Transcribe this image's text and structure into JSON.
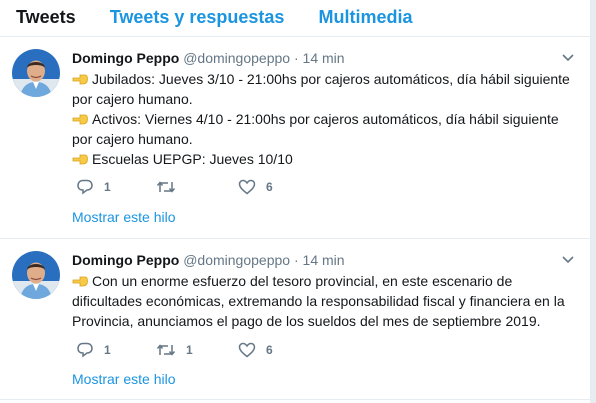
{
  "tabs": {
    "tweets": "Tweets",
    "replies": "Tweets y respuestas",
    "media": "Multimedia"
  },
  "tweets": [
    {
      "name": "Domingo Peppo",
      "handle": "@domingopeppo",
      "separator": "·",
      "time": "14 min",
      "lines": [
        "Jubilados: Jueves 3/10 - 21:00hs por cajeros automáticos, día hábil siguiente",
        "por cajero humano.",
        "Activos: Viernes 4/10 - 21:00hs por cajeros automáticos, día hábil siguiente",
        "por cajero humano.",
        "Escuelas UEPGP: Jueves 10/10"
      ],
      "replies": "1",
      "retweets": "",
      "likes": "6",
      "show_thread": "Mostrar este hilo"
    },
    {
      "name": "Domingo Peppo",
      "handle": "@domingopeppo",
      "separator": "·",
      "time": "14 min",
      "lines": [
        "Con un enorme esfuerzo del tesoro provincial, en este escenario de",
        "dificultades económicas, extremando la responsabilidad fiscal y financiera en la",
        "Provincia, anunciamos el pago de los sueldos del mes de septiembre 2019."
      ],
      "replies": "1",
      "retweets": "1",
      "likes": "6",
      "show_thread": "Mostrar este hilo"
    }
  ],
  "icons": {
    "emoji": "backhand-index-pointing-left",
    "reply": "reply-icon",
    "retweet": "retweet-icon",
    "like": "heart-icon",
    "caret": "chevron-down-icon"
  },
  "colors": {
    "link": "#1b95e0",
    "muted": "#657786",
    "text": "#14171a",
    "emoji": "#f7c948"
  }
}
